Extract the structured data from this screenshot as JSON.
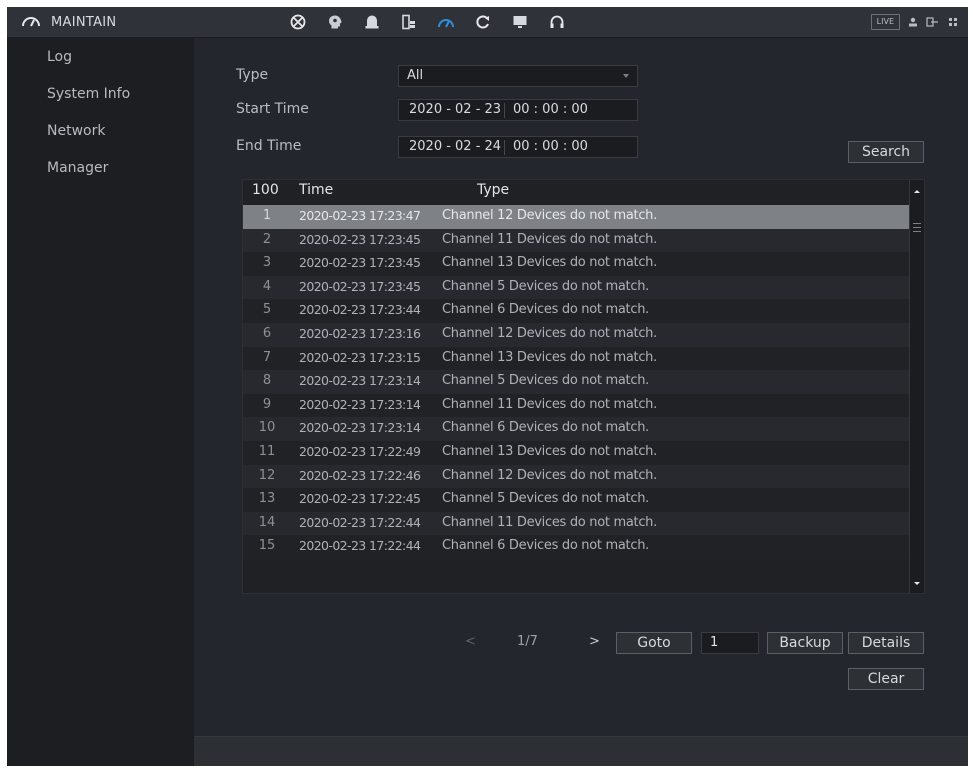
{
  "header": {
    "title": "MAINTAIN",
    "nav_icons": [
      "ptz-icon",
      "smart-icon",
      "alarm-icon",
      "storage-icon",
      "maintain-icon",
      "backup-icon",
      "display-icon",
      "audio-icon"
    ],
    "live_label": "LIVE"
  },
  "sidebar": {
    "items": [
      {
        "label": "Log"
      },
      {
        "label": "System Info"
      },
      {
        "label": "Network"
      },
      {
        "label": "Manager"
      }
    ]
  },
  "filters": {
    "type_label": "Type",
    "type_value": "All",
    "start_label": "Start Time",
    "start_date": "2020 - 02 - 23",
    "start_time": "00 : 00 : 00",
    "end_label": "End Time",
    "end_date": "2020 - 02 - 24",
    "end_time": "00 : 00 : 00",
    "search_label": "Search"
  },
  "table": {
    "columns": {
      "count": "100",
      "time": "Time",
      "type": "Type"
    },
    "rows": [
      {
        "no": "1",
        "time": "2020-02-23 17:23:47",
        "type": "Channel 12 Devices do not match."
      },
      {
        "no": "2",
        "time": "2020-02-23 17:23:45",
        "type": "Channel 11 Devices do not match."
      },
      {
        "no": "3",
        "time": "2020-02-23 17:23:45",
        "type": "Channel 13 Devices do not match."
      },
      {
        "no": "4",
        "time": "2020-02-23 17:23:45",
        "type": "Channel 5 Devices do not match."
      },
      {
        "no": "5",
        "time": "2020-02-23 17:23:44",
        "type": "Channel 6 Devices do not match."
      },
      {
        "no": "6",
        "time": "2020-02-23 17:23:16",
        "type": "Channel 12 Devices do not match."
      },
      {
        "no": "7",
        "time": "2020-02-23 17:23:15",
        "type": "Channel 13 Devices do not match."
      },
      {
        "no": "8",
        "time": "2020-02-23 17:23:14",
        "type": "Channel 5 Devices do not match."
      },
      {
        "no": "9",
        "time": "2020-02-23 17:23:14",
        "type": "Channel 11 Devices do not match."
      },
      {
        "no": "10",
        "time": "2020-02-23 17:23:14",
        "type": "Channel 6 Devices do not match."
      },
      {
        "no": "11",
        "time": "2020-02-23 17:22:49",
        "type": "Channel 13 Devices do not match."
      },
      {
        "no": "12",
        "time": "2020-02-23 17:22:46",
        "type": "Channel 12 Devices do not match."
      },
      {
        "no": "13",
        "time": "2020-02-23 17:22:45",
        "type": "Channel 5 Devices do not match."
      },
      {
        "no": "14",
        "time": "2020-02-23 17:22:44",
        "type": "Channel 11 Devices do not match."
      },
      {
        "no": "15",
        "time": "2020-02-23 17:22:44",
        "type": "Channel 6 Devices do not match."
      }
    ]
  },
  "pagination": {
    "prev": "<",
    "page": "1/7",
    "next": ">",
    "goto_label": "Goto",
    "goto_value": "1"
  },
  "actions": {
    "backup_label": "Backup",
    "details_label": "Details",
    "clear_label": "Clear"
  },
  "colors": {
    "background": "#23262c",
    "sidebar": "#1c1e22",
    "selected_row": "#7e8186",
    "accent": "#2f8fd8"
  }
}
